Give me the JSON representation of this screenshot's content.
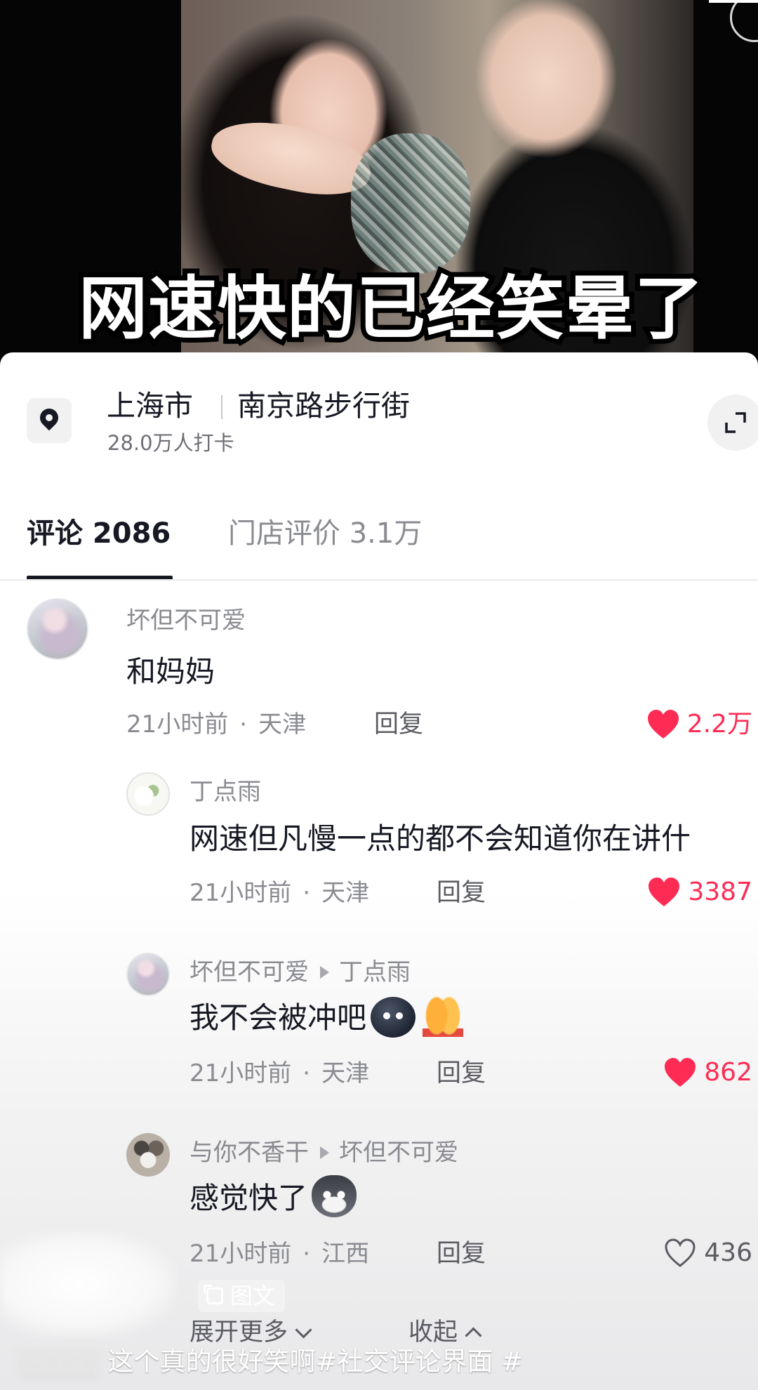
{
  "video": {
    "caption": "网速快的已经笑晕了"
  },
  "location": {
    "city": "上海市",
    "place": "南京路步行街",
    "checkins": "28.0万人打卡",
    "pin_icon": "location-pin-icon",
    "expand_icon": "expand-icon"
  },
  "tabs": {
    "comments": "评论 2086",
    "reviews": "门店评价 3.1万"
  },
  "comments": [
    {
      "user": "坏但不可爱",
      "text": "和妈妈",
      "time": "21小时前",
      "region": "天津",
      "reply": "回复",
      "likes": "2.2万",
      "liked": true
    },
    {
      "user": "丁点雨",
      "text": "网速但凡慢一点的都不会知道你在讲什",
      "time": "21小时前",
      "region": "天津",
      "reply": "回复",
      "likes": "3387",
      "liked": true
    },
    {
      "user": "坏但不可爱",
      "reply_to": "丁点雨",
      "text": "我不会被冲吧",
      "emojis": [
        "dark-bird-emoji",
        "praying-hands-emoji"
      ],
      "time": "21小时前",
      "region": "天津",
      "reply": "回复",
      "likes": "862",
      "liked": true
    },
    {
      "user": "与你不香干",
      "reply_to": "坏但不可爱",
      "text": "感觉快了",
      "emojis": [
        "husky-emoji"
      ],
      "time": "21小时前",
      "region": "江西",
      "reply": "回复",
      "likes": "436",
      "liked": false
    }
  ],
  "footer": {
    "tag": "图文",
    "expand_more": "展开更多",
    "collapse": "收起",
    "description": "这个真的很好笑啊#社交评论界面 #"
  },
  "colors": {
    "like_active": "#fe2c55",
    "text_primary": "#161823",
    "text_secondary": "#8a8b91"
  }
}
